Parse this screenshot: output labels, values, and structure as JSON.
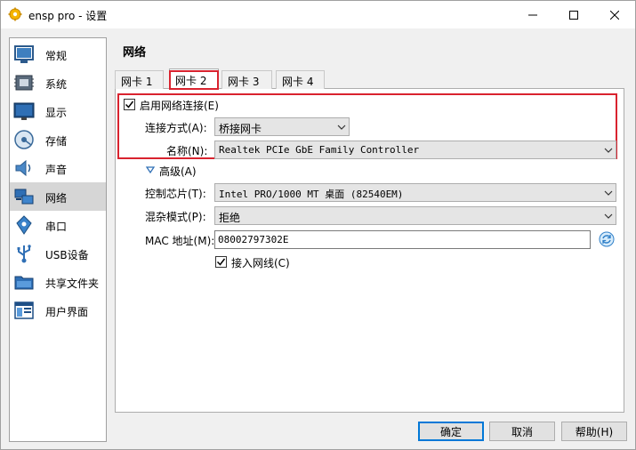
{
  "window": {
    "title": "ensp pro - 设置",
    "controls": {
      "minimize": "minimize-icon",
      "maximize": "maximize-icon",
      "close": "close-icon"
    }
  },
  "sidebar": {
    "items": [
      {
        "label": "常规",
        "icon": "general-icon"
      },
      {
        "label": "系统",
        "icon": "system-icon"
      },
      {
        "label": "显示",
        "icon": "display-icon"
      },
      {
        "label": "存储",
        "icon": "storage-icon"
      },
      {
        "label": "声音",
        "icon": "audio-icon"
      },
      {
        "label": "网络",
        "icon": "network-icon",
        "selected": true
      },
      {
        "label": "串口",
        "icon": "serial-port-icon"
      },
      {
        "label": "USB设备",
        "icon": "usb-icon"
      },
      {
        "label": "共享文件夹",
        "icon": "shared-folder-icon"
      },
      {
        "label": "用户界面",
        "icon": "user-interface-icon"
      }
    ]
  },
  "main": {
    "title": "网络",
    "tabs": [
      {
        "label": "网卡 1"
      },
      {
        "label": "网卡 2",
        "active": true
      },
      {
        "label": "网卡 3"
      },
      {
        "label": "网卡 4"
      }
    ],
    "adapter": {
      "enable_label": "启用网络连接(E)",
      "enabled": true,
      "attached_label": "连接方式(A):",
      "attached_value": "桥接网卡",
      "name_label": "名称(N):",
      "name_value": "Realtek PCIe GbE Family Controller",
      "advanced_label": "高级(A)",
      "chip_label": "控制芯片(T):",
      "chip_value": "Intel PRO/1000 MT 桌面 (82540EM)",
      "promisc_label": "混杂模式(P):",
      "promisc_value": "拒绝",
      "mac_label": "MAC 地址(M):",
      "mac_value": "08002797302E",
      "cable_label": "接入网线(C)",
      "cable_connected": true
    }
  },
  "buttons": {
    "ok": "确定",
    "cancel": "取消",
    "help": "帮助(H)"
  },
  "colors": {
    "highlight_box": "#d9232f",
    "accent": "#0078d7",
    "selected_bg": "#d6d6d6"
  }
}
